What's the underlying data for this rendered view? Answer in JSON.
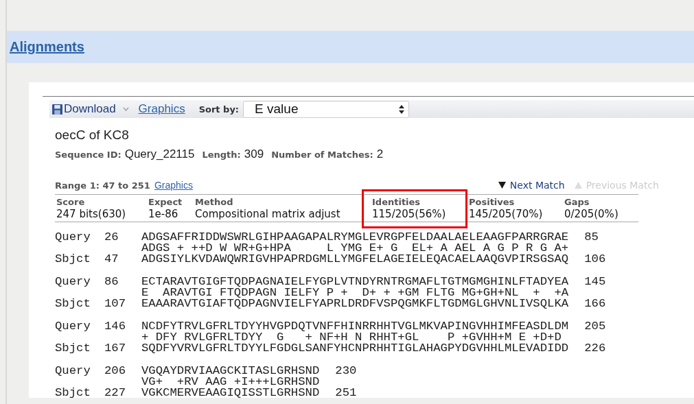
{
  "section_title": "Alignments",
  "toolbar": {
    "download": "Download",
    "graphics": "Graphics",
    "sort_label": "Sort by:",
    "sort_value": "E value"
  },
  "hit": {
    "title": "oecC of KC8",
    "sequence_id_label": "Sequence ID:",
    "sequence_id": "Query_22115",
    "length_label": "Length:",
    "length": "309",
    "matches_label": "Number of Matches:",
    "matches": "2"
  },
  "range": {
    "label": "Range 1: 47 to 251",
    "graphics": "Graphics"
  },
  "match_nav": [
    {
      "kind": "next",
      "label": "Next Match",
      "disabled": false
    },
    {
      "kind": "previous",
      "label": "Previous Match",
      "disabled": true
    }
  ],
  "scores": [
    {
      "heading": "Score",
      "value": "247 bits(630)",
      "highlighted": false
    },
    {
      "heading": "Expect",
      "value": "1e-86",
      "highlighted": false
    },
    {
      "heading": "Method",
      "value": "Compositional matrix adjust",
      "highlighted": false
    },
    {
      "heading": "Identities",
      "value": "115/205(56%)",
      "highlighted": true
    },
    {
      "heading": "Positives",
      "value": "145/205(70%)",
      "highlighted": false
    },
    {
      "heading": "Gaps",
      "value": "0/205(0%)",
      "highlighted": false
    }
  ],
  "alignment": [
    {
      "query_label": "Query",
      "query_start": "26",
      "query": "ADGSAFFRIDDWSWRLGIHPAAGAPALRYMGLEVRGPFELDAALAELEAAGFPARRGRAE",
      "query_end": "85",
      "midline": "ADGS + ++D W WR+G+HPA     L YMG E+ G  EL+ A AEL A G P R G A+",
      "subject_label": "Sbjct",
      "subject_start": "47",
      "subject": "ADGSIYLKVDAWQWRIGVHPAPRDGMLLYMGFELAGEIELEQACAELAAQGVPIRSGSAQ",
      "subject_end": "106"
    },
    {
      "query_label": "Query",
      "query_start": "86",
      "query": "ECTARAVTGIGFTQDPAGNAIELFYGPLVTNDYRNTRGMAFLTGTMGMGHINLFTADYEA",
      "query_end": "145",
      "midline": "E  ARAVTGI FTQDPAGN IELFY P +  D+ + +GM FLTG MG+GH+NL  +  +A",
      "subject_label": "Sbjct",
      "subject_start": "107",
      "subject": "EAAARAVTGIAFTQDPAGNVIELFYAPRLDRDFVSPQGMKFLTGDMGLGHVNLIVSQLKA",
      "subject_end": "166"
    },
    {
      "query_label": "Query",
      "query_start": "146",
      "query": "NCDFYTRVLGFRLTDYYHVGPDQTVNFFHINRRHHTVGLMKVAPINGVHHIMFEASDLDM",
      "query_end": "205",
      "midline": "+ DFY RVLGFRLTDYY  G   + NF+H N RHHT+GL    P +GVHH+M E +D+D",
      "subject_label": "Sbjct",
      "subject_start": "167",
      "subject": "SQDFYVRVLGFRLTDYYLFGDGLSANFYHCNPRHHTIGLAHAGPYDGVHHLMLEVADIDD",
      "subject_end": "226"
    },
    {
      "query_label": "Query",
      "query_start": "206",
      "query": "VGQAYDRVIAAGCKITASLGRHSND",
      "query_end": "230",
      "midline": "VG+  +RV AAG +I+++LGRHSND",
      "subject_label": "Sbjct",
      "subject_start": "227",
      "subject": "VGKCMERVEAAGIQISSTLGRHSND",
      "subject_end": "251"
    }
  ]
}
